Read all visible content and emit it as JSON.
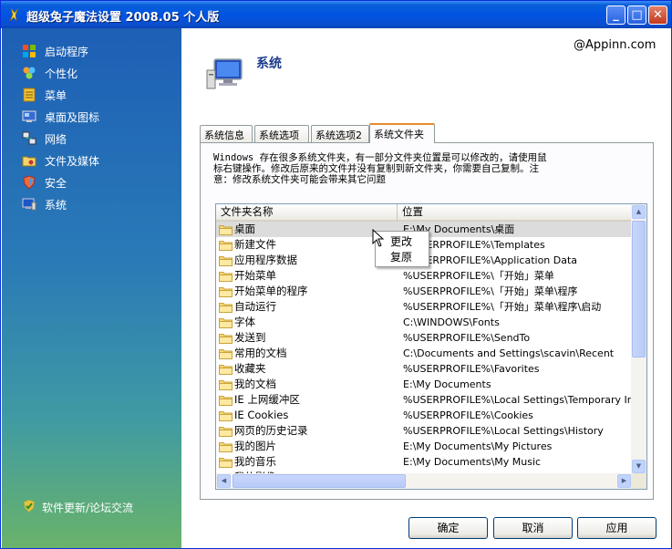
{
  "window": {
    "title": "超级兔子魔法设置 2008.05 个人版",
    "controls": {
      "minimize": "_",
      "maximize": "□",
      "close": "✕"
    }
  },
  "sidebar": {
    "items": [
      {
        "label": "启动程序",
        "icon": "startup-icon"
      },
      {
        "label": "个性化",
        "icon": "personalize-icon"
      },
      {
        "label": "菜单",
        "icon": "menu-icon"
      },
      {
        "label": "桌面及图标",
        "icon": "desktop-icon"
      },
      {
        "label": "网络",
        "icon": "network-icon"
      },
      {
        "label": "文件及媒体",
        "icon": "file-media-icon"
      },
      {
        "label": "安全",
        "icon": "security-icon"
      },
      {
        "label": "系统",
        "icon": "system-icon"
      }
    ],
    "footer": "软件更新/论坛交流"
  },
  "content": {
    "credit": "@Appinn.com",
    "heading": "系统",
    "tabs": [
      "系统信息",
      "系统选项",
      "系统选项2",
      "系统文件夹"
    ],
    "active_tab": "系统文件夹",
    "description": "Windows 存在很多系统文件夹，有一部分文件夹位置是可以修改的，请使用鼠\n标右键操作。修改后原来的文件并没有复制到新文件夹，你需要自己复制。注\n意：修改系统文件夹可能会带来其它问题"
  },
  "folder_list": {
    "columns": [
      "文件夹名称",
      "位置"
    ],
    "rows": [
      {
        "name": "桌面",
        "location": "E:\\My Documents\\桌面"
      },
      {
        "name": "新建文件",
        "location": "%USERPROFILE%\\Templates"
      },
      {
        "name": "应用程序数据",
        "location": "%USERPROFILE%\\Application Data"
      },
      {
        "name": "开始菜单",
        "location": "%USERPROFILE%\\「开始」菜单"
      },
      {
        "name": "开始菜单的程序",
        "location": "%USERPROFILE%\\「开始」菜单\\程序"
      },
      {
        "name": "自动运行",
        "location": "%USERPROFILE%\\「开始」菜单\\程序\\启动"
      },
      {
        "name": "字体",
        "location": "C:\\WINDOWS\\Fonts"
      },
      {
        "name": "发送到",
        "location": "%USERPROFILE%\\SendTo"
      },
      {
        "name": "常用的文档",
        "location": "C:\\Documents and Settings\\scavin\\Recent"
      },
      {
        "name": "收藏夹",
        "location": "%USERPROFILE%\\Favorites"
      },
      {
        "name": "我的文档",
        "location": "E:\\My Documents"
      },
      {
        "name": "IE 上网缓冲区",
        "location": "%USERPROFILE%\\Local Settings\\Temporary Interne"
      },
      {
        "name": "IE Cookies",
        "location": "%USERPROFILE%\\Cookies"
      },
      {
        "name": "网页的历史记录",
        "location": "%USERPROFILE%\\Local Settings\\History"
      },
      {
        "name": "我的图片",
        "location": "E:\\My Documents\\My Pictures"
      },
      {
        "name": "我的音乐",
        "location": "E:\\My Documents\\My Music"
      },
      {
        "name": "我的影像",
        "location": "E:\\My Documents\\My Videos"
      }
    ]
  },
  "context_menu": {
    "items": [
      "更改",
      "复原"
    ]
  },
  "buttons": {
    "ok": "确定",
    "cancel": "取消",
    "apply": "应用"
  }
}
